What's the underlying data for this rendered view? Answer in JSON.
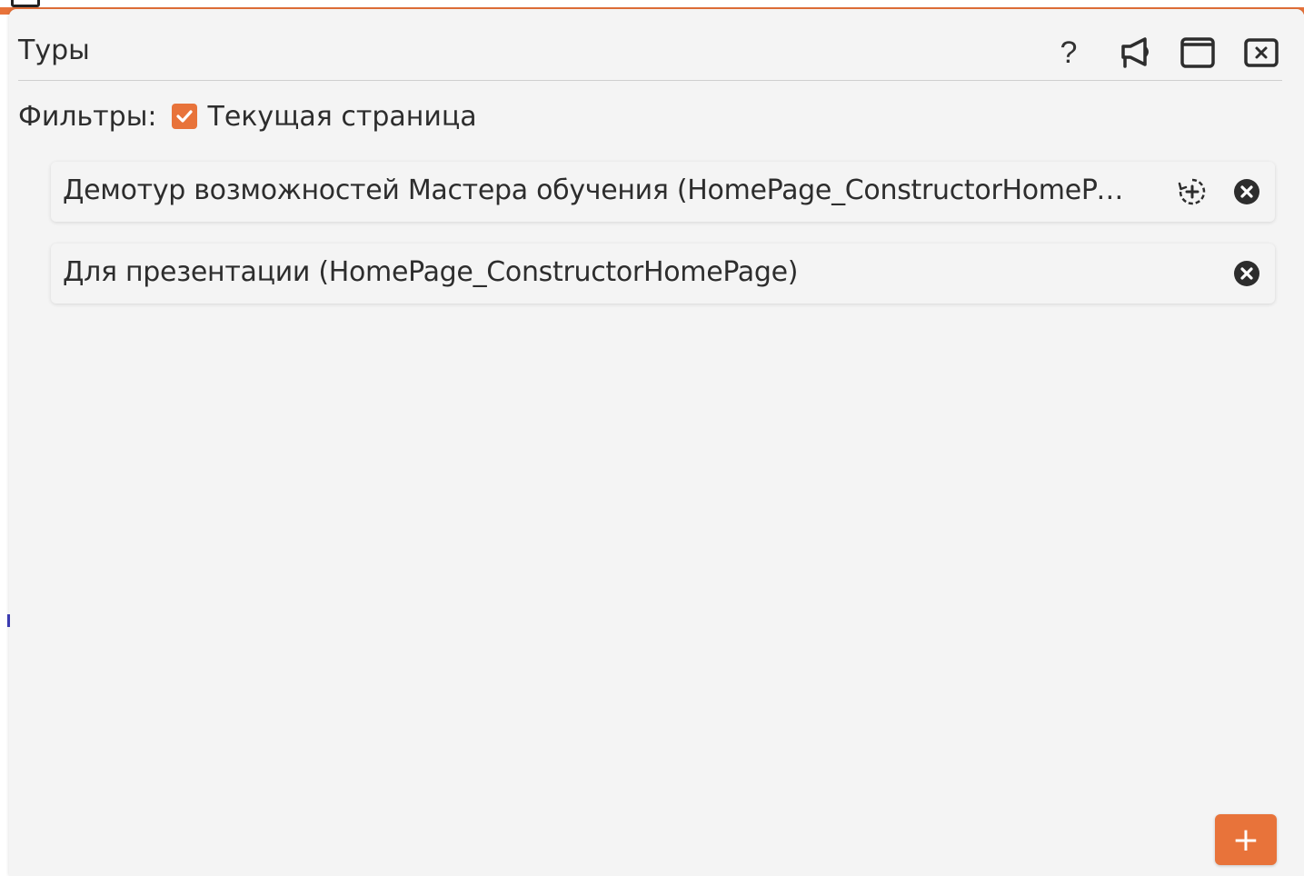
{
  "panel": {
    "title": "Туры",
    "help_label": "?",
    "accent_color": "#e8733a"
  },
  "filters": {
    "label": "Фильтры:",
    "current_page_label": "Текущая страница",
    "current_page_checked": true
  },
  "tours": [
    {
      "label": "Демотур возможностей Мастера обучения (HomePage_ConstructorHomePage)",
      "has_launch": true
    },
    {
      "label": "Для презентации (HomePage_ConstructorHomePage)",
      "has_launch": false
    }
  ],
  "add_button": {
    "label": "+"
  }
}
